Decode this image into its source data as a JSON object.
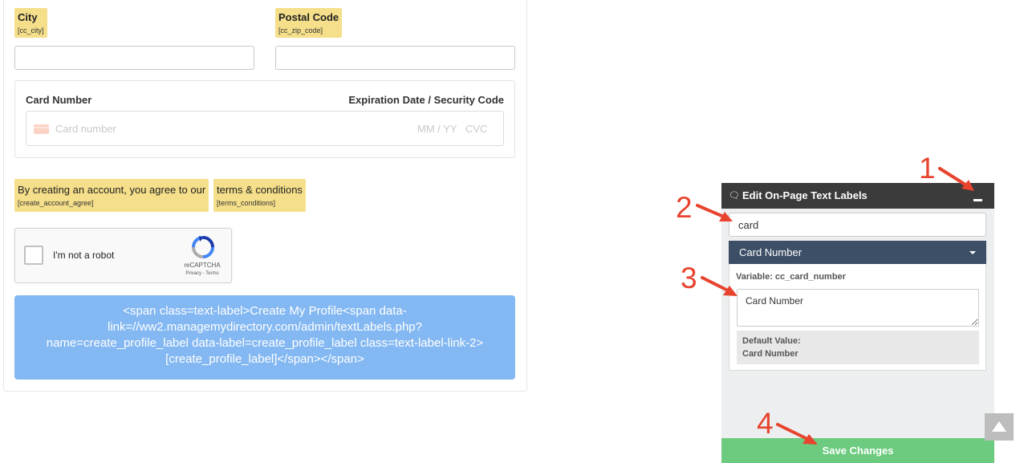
{
  "form": {
    "city": {
      "label": "City",
      "variable": "[cc_city]",
      "value": ""
    },
    "postal": {
      "label": "Postal Code",
      "variable": "[cc_zip_code]",
      "value": ""
    },
    "card": {
      "number_label": "Card Number",
      "expiry_label": "Expiration Date / Security Code",
      "number_placeholder": "Card number",
      "expiry_placeholder": "MM / YY",
      "cvc_placeholder": "CVC"
    },
    "agree": {
      "label": "By creating an account, you agree to our",
      "variable": "[create_account_agree]"
    },
    "terms": {
      "label": "terms & conditions",
      "variable": "[terms_conditions]"
    },
    "recaptcha": {
      "label": "I'm not a robot",
      "brand": "reCAPTCHA",
      "links": "Privacy - Terms"
    },
    "submit_label": "<span class=text-label>Create My Profile<span data-link=//ww2.managemydirectory.com/admin/textLabels.php?name=create_profile_label data-label=create_profile_label class=text-label-link-2>[create_profile_label]</span></span>"
  },
  "editor": {
    "title": "Edit On-Page Text Labels",
    "search_value": "card",
    "item": {
      "title": "Card Number",
      "variable_text": "Variable: cc_card_number",
      "value": "Card Number",
      "default_label": "Default Value:",
      "default_value": "Card Number"
    },
    "save_label": "Save Changes"
  },
  "annotations": {
    "step1": "1",
    "step2": "2",
    "step3": "3",
    "step4": "4"
  },
  "icons": {
    "chat": "chat-bubbles-icon",
    "minimize": "minimize-icon",
    "caret": "caret-down-icon",
    "card": "credit-card-icon",
    "recaptcha": "recaptcha-logo-icon",
    "scroll_top": "arrow-up-icon"
  },
  "colors": {
    "label_highlight": "#f5df8a",
    "submit_button": "#84b8f2",
    "editor_titlebar": "#3b3b3b",
    "accordion_header": "#3d4f66",
    "save_button": "#6ccb7f",
    "annotation": "#e8432e"
  }
}
